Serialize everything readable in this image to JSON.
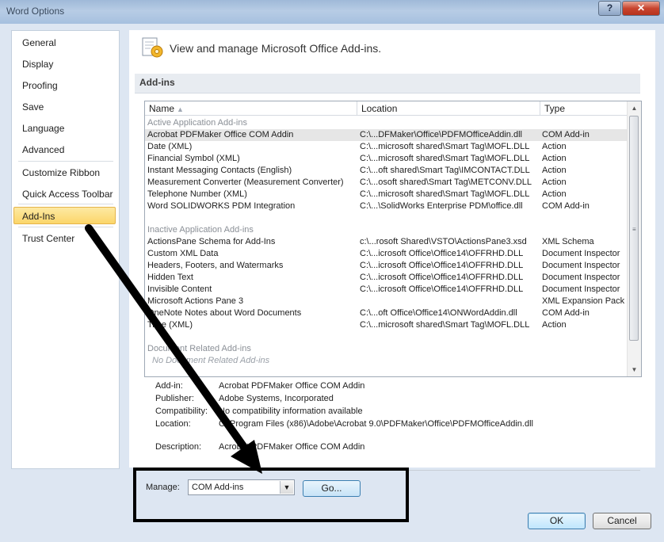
{
  "window": {
    "title": "Word Options",
    "help_label": "?",
    "close_label": "✕"
  },
  "nav": {
    "items": [
      {
        "label": "General"
      },
      {
        "label": "Display"
      },
      {
        "label": "Proofing"
      },
      {
        "label": "Save"
      },
      {
        "label": "Language"
      },
      {
        "label": "Advanced"
      },
      {
        "label": "Customize Ribbon"
      },
      {
        "label": "Quick Access Toolbar"
      },
      {
        "label": "Add-Ins"
      },
      {
        "label": "Trust Center"
      }
    ],
    "selected": "Add-Ins"
  },
  "header": {
    "icon": "add-ins-gear-icon",
    "text": "View and manage Microsoft Office Add-ins."
  },
  "section": {
    "title": "Add-ins"
  },
  "table": {
    "columns": [
      "Name",
      "Location",
      "Type"
    ],
    "sort_indicator": "▲",
    "active_group": "Active Application Add-ins",
    "active_rows": [
      {
        "name": "Acrobat PDFMaker Office COM Addin",
        "location": "C:\\...DFMaker\\Office\\PDFMOfficeAddin.dll",
        "type": "COM Add-in"
      },
      {
        "name": "Date (XML)",
        "location": "C:\\...microsoft shared\\Smart Tag\\MOFL.DLL",
        "type": "Action"
      },
      {
        "name": "Financial Symbol (XML)",
        "location": "C:\\...microsoft shared\\Smart Tag\\MOFL.DLL",
        "type": "Action"
      },
      {
        "name": "Instant Messaging Contacts (English)",
        "location": "C:\\...oft shared\\Smart Tag\\IMCONTACT.DLL",
        "type": "Action"
      },
      {
        "name": "Measurement Converter (Measurement Converter)",
        "location": "C:\\...osoft shared\\Smart Tag\\METCONV.DLL",
        "type": "Action"
      },
      {
        "name": "Telephone Number (XML)",
        "location": "C:\\...microsoft shared\\Smart Tag\\MOFL.DLL",
        "type": "Action"
      },
      {
        "name": "Word SOLIDWORKS PDM Integration",
        "location": "C:\\...\\SolidWorks Enterprise PDM\\office.dll",
        "type": "COM Add-in"
      }
    ],
    "inactive_group": "Inactive Application Add-ins",
    "inactive_rows": [
      {
        "name": "ActionsPane Schema for Add-Ins",
        "location": "c:\\...rosoft Shared\\VSTO\\ActionsPane3.xsd",
        "type": "XML Schema"
      },
      {
        "name": "Custom XML Data",
        "location": "C:\\...icrosoft Office\\Office14\\OFFRHD.DLL",
        "type": "Document Inspector"
      },
      {
        "name": "Headers, Footers, and Watermarks",
        "location": "C:\\...icrosoft Office\\Office14\\OFFRHD.DLL",
        "type": "Document Inspector"
      },
      {
        "name": "Hidden Text",
        "location": "C:\\...icrosoft Office\\Office14\\OFFRHD.DLL",
        "type": "Document Inspector"
      },
      {
        "name": "Invisible Content",
        "location": "C:\\...icrosoft Office\\Office14\\OFFRHD.DLL",
        "type": "Document Inspector"
      },
      {
        "name": "Microsoft Actions Pane 3",
        "location": "",
        "type": "XML Expansion Pack"
      },
      {
        "name": "OneNote Notes about Word Documents",
        "location": "C:\\...oft Office\\Office14\\ONWordAddin.dll",
        "type": "COM Add-in"
      },
      {
        "name": "Time (XML)",
        "location": "C:\\...microsoft shared\\Smart Tag\\MOFL.DLL",
        "type": "Action"
      }
    ],
    "doc_group": "Document Related Add-ins",
    "doc_empty": "No Document Related Add-ins",
    "grip": "≡"
  },
  "details": [
    {
      "label": "Add-in:",
      "value": "Acrobat PDFMaker Office COM Addin"
    },
    {
      "label": "Publisher:",
      "value": "Adobe Systems, Incorporated"
    },
    {
      "label": "Compatibility:",
      "value": "No compatibility information available"
    },
    {
      "label": "Location:",
      "value": "C:\\Program Files (x86)\\Adobe\\Acrobat 9.0\\PDFMaker\\Office\\PDFMOfficeAddin.dll"
    },
    {
      "label": "Description:",
      "value": "Acrobat PDFMaker Office COM Addin"
    }
  ],
  "manage": {
    "label": "Manage:",
    "selected": "COM Add-ins",
    "go_label": "Go..."
  },
  "footer": {
    "ok_label": "OK",
    "cancel_label": "Cancel"
  },
  "colors": {
    "selected_nav": "#fbd66a",
    "annotation": "#000000"
  }
}
